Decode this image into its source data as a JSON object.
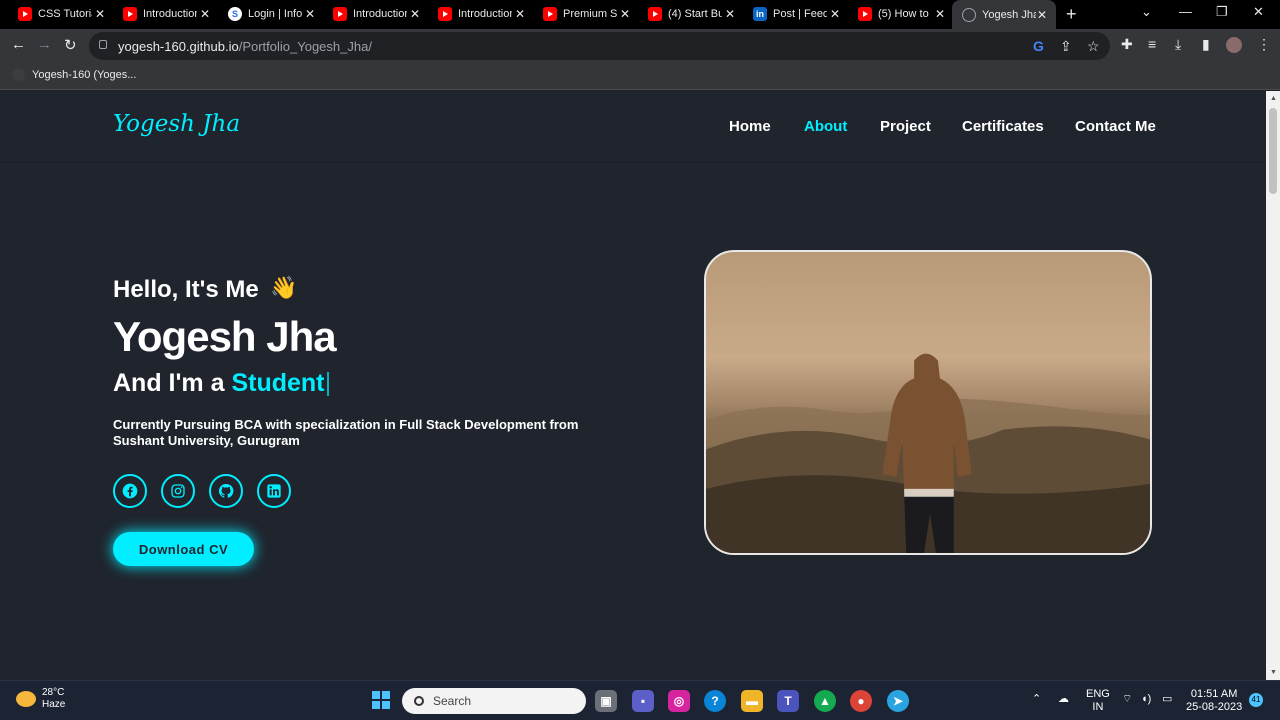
{
  "browser": {
    "tabs": [
      {
        "label": "CSS Tutorial",
        "icon": "youtube-icon"
      },
      {
        "label": "Introduction",
        "icon": "youtube-icon"
      },
      {
        "label": "Login | Info",
        "icon": "site-icon"
      },
      {
        "label": "Introduction",
        "icon": "youtube-icon"
      },
      {
        "label": "Introduction",
        "icon": "youtube-icon"
      },
      {
        "label": "Premium Sp",
        "icon": "youtube-icon"
      },
      {
        "label": "(4) Start Bu",
        "icon": "youtube-icon"
      },
      {
        "label": "Post | Feed",
        "icon": "linkedin-icon"
      },
      {
        "label": "(5) How to",
        "icon": "youtube-icon"
      },
      {
        "label": "Yogesh Jha",
        "icon": "globe-icon"
      }
    ],
    "url_host": "yogesh-160.github.io",
    "url_path": "/Portfolio_Yogesh_Jha/",
    "bookmark": "Yogesh-160 (Yoges..."
  },
  "site": {
    "logo": "Yogesh Jha",
    "nav": [
      "Home",
      "About",
      "Project",
      "Certificates",
      "Contact Me"
    ],
    "active_nav": "About",
    "greeting": "Hello, It's Me",
    "greeting_emoji": "👋",
    "name": "Yogesh Jha",
    "role_prefix": "And I'm a",
    "role_highlight": "Student",
    "bio": "Currently Pursuing BCA with specialization in Full Stack Development from Sushant University, Gurugram",
    "socials": [
      "facebook-icon",
      "instagram-icon",
      "github-icon",
      "linkedin-icon"
    ],
    "cta": "Download CV",
    "accent": "#00eeff",
    "bg": "#1f242d"
  },
  "taskbar": {
    "temp": "28°C",
    "weather": "Haze",
    "search": "Search",
    "lang1": "ENG",
    "lang2": "IN",
    "time": "01:51 AM",
    "date": "25-08-2023",
    "notif": "41"
  }
}
